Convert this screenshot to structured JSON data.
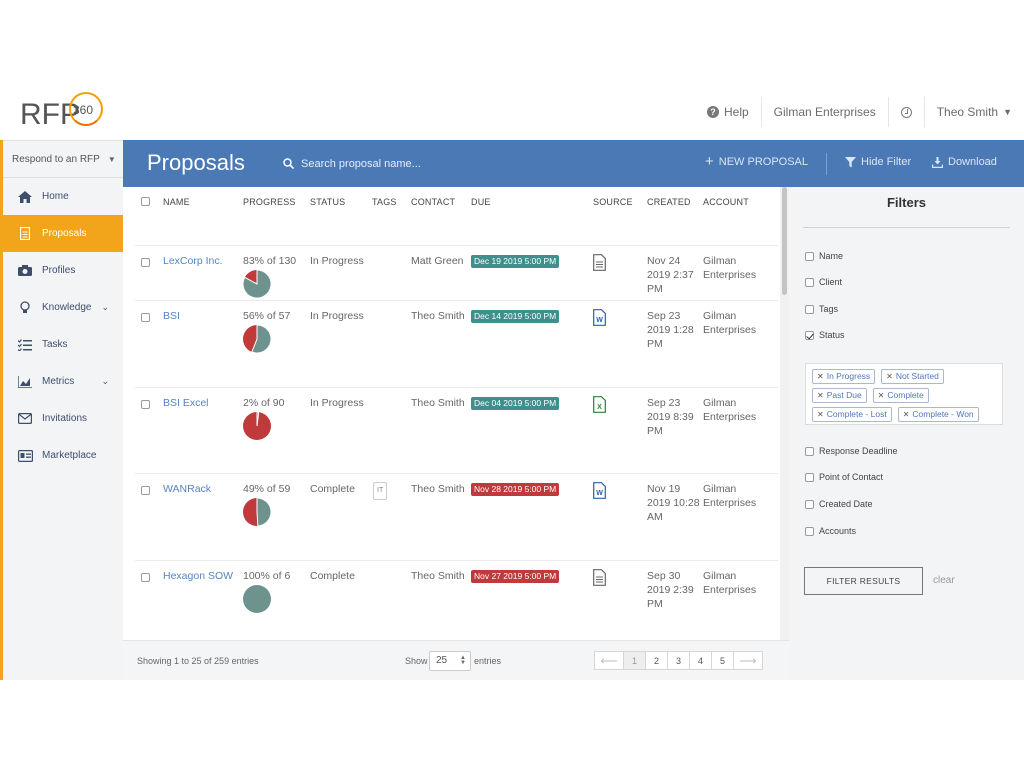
{
  "header": {
    "logo_text": "RFP",
    "logo_num": "360",
    "help": "Help",
    "company": "Gilman Enterprises",
    "user": "Theo Smith"
  },
  "sidebar": {
    "respond": "Respond to an RFP",
    "items": [
      {
        "label": "Home",
        "icon": "home-icon"
      },
      {
        "label": "Proposals",
        "icon": "document-icon"
      },
      {
        "label": "Profiles",
        "icon": "camera-icon"
      },
      {
        "label": "Knowledge",
        "icon": "lightbulb-icon"
      },
      {
        "label": "Tasks",
        "icon": "checklist-icon"
      },
      {
        "label": "Metrics",
        "icon": "chart-icon"
      },
      {
        "label": "Invitations",
        "icon": "envelope-icon"
      },
      {
        "label": "Marketplace",
        "icon": "id-card-icon"
      }
    ]
  },
  "toolbar": {
    "title": "Proposals",
    "search_placeholder": "Search proposal name...",
    "new_proposal": "NEW PROPOSAL",
    "hide_filter": "Hide Filter",
    "download": "Download"
  },
  "table": {
    "columns": [
      "NAME",
      "PROGRESS",
      "STATUS",
      "TAGS",
      "CONTACT",
      "DUE",
      "SOURCE",
      "CREATED",
      "ACCOUNT"
    ],
    "rows": [
      {
        "name": "LexCorp Inc.",
        "progress": "83% of 130",
        "pct": 83,
        "status": "In Progress",
        "tag": "",
        "contact": "Matt Green",
        "due": "Dec 19 2019 5:00 PM",
        "due_color": "teal",
        "source": "doc",
        "created": "Nov 24 2019 2:37 PM",
        "account": "Gilman Enterprises"
      },
      {
        "name": "BSI",
        "progress": "56% of 57",
        "pct": 56,
        "status": "In Progress",
        "tag": "",
        "contact": "Theo Smith",
        "due": "Dec 14 2019 5:00 PM",
        "due_color": "teal",
        "source": "word",
        "created": "Sep 23 2019 1:28 PM",
        "account": "Gilman Enterprises"
      },
      {
        "name": "BSI Excel",
        "progress": "2% of 90",
        "pct": 2,
        "status": "In Progress",
        "tag": "",
        "contact": "Theo Smith",
        "due": "Dec 04 2019 5:00 PM",
        "due_color": "teal",
        "source": "excel",
        "created": "Sep 23 2019 8:39 PM",
        "account": "Gilman Enterprises"
      },
      {
        "name": "WANRack",
        "progress": "49% of 59",
        "pct": 49,
        "status": "Complete",
        "tag": "IT",
        "contact": "Theo Smith",
        "due": "Nov 28 2019 5:00 PM",
        "due_color": "red",
        "source": "word",
        "created": "Nov 19 2019 10:28 AM",
        "account": "Gilman Enterprises"
      },
      {
        "name": "Hexagon SOW",
        "progress": "100% of 6",
        "pct": 100,
        "status": "Complete",
        "tag": "",
        "contact": "Theo Smith",
        "due": "Nov 27 2019 5:00 PM",
        "due_color": "red",
        "source": "doc",
        "created": "Sep 30 2019 2:39 PM",
        "account": "Gilman Enterprises"
      }
    ]
  },
  "footer": {
    "showing": "Showing 1 to 25 of 259 entries",
    "show": "Show",
    "page_size": "25",
    "entries": "entries",
    "pages": [
      "1",
      "2",
      "3",
      "4",
      "5"
    ],
    "current_page": "1"
  },
  "filters": {
    "title": "Filters",
    "options_top": [
      {
        "label": "Name",
        "checked": false
      },
      {
        "label": "Client",
        "checked": false
      },
      {
        "label": "Tags",
        "checked": false
      },
      {
        "label": "Status",
        "checked": true
      }
    ],
    "chips": [
      "In Progress",
      "Not Started",
      "Past Due",
      "Complete",
      "Complete - Lost",
      "Complete - Won"
    ],
    "options_bottom": [
      {
        "label": "Response Deadline",
        "checked": false
      },
      {
        "label": "Point of Contact",
        "checked": false
      },
      {
        "label": "Created Date",
        "checked": false
      },
      {
        "label": "Accounts",
        "checked": false
      }
    ],
    "filter_button": "FILTER RESULTS",
    "clear": "clear"
  },
  "colors": {
    "accent": "#f2a51a",
    "toolbar": "#4a79b6",
    "due_teal": "#3f8f8c",
    "due_red": "#c0393b",
    "pie_done": "#6e938e",
    "pie_todo": "#c0393b"
  }
}
